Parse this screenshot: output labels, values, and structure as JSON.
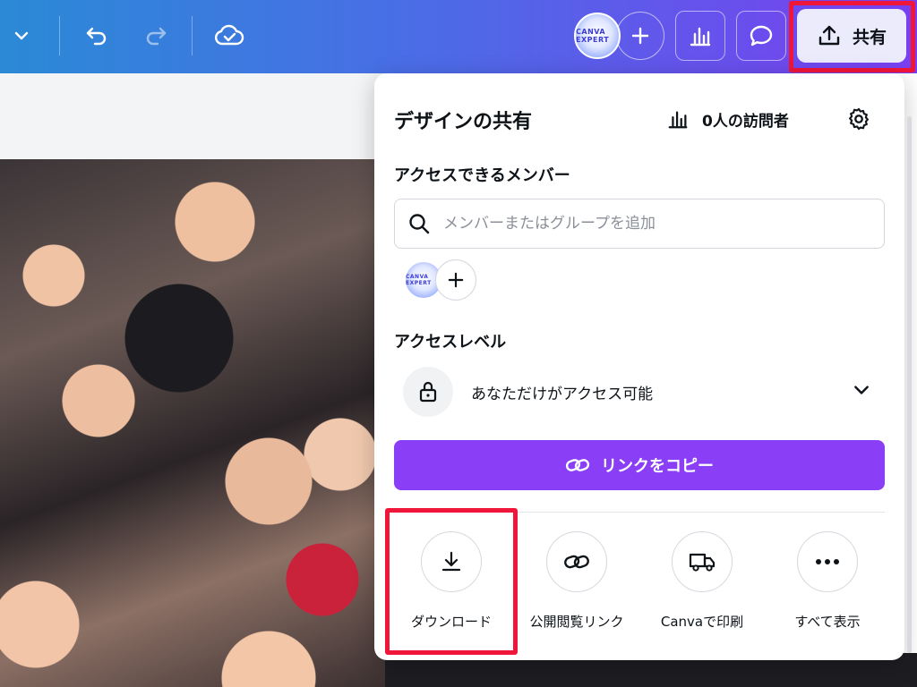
{
  "topbar": {
    "avatar_text": "CANVA EXPERT",
    "share_label": "共有"
  },
  "panel": {
    "title": "デザインの共有",
    "visitors": "0人の訪問者",
    "members_label": "アクセスできるメンバー",
    "search_placeholder": "メンバーまたはグループを追加",
    "access_level_label": "アクセスレベル",
    "access_value": "あなただけがアクセス可能",
    "copy_link": "リンクをコピー",
    "actions": [
      {
        "label": "ダウンロード",
        "icon": "download-icon"
      },
      {
        "label": "公開閲覧リンク",
        "icon": "link-icon"
      },
      {
        "label": "Canvaで印刷",
        "icon": "truck-icon"
      },
      {
        "label": "すべて表示",
        "icon": "more-icon"
      }
    ]
  },
  "colors": {
    "accent": "#8a3ef5",
    "highlight": "#f0163a"
  }
}
